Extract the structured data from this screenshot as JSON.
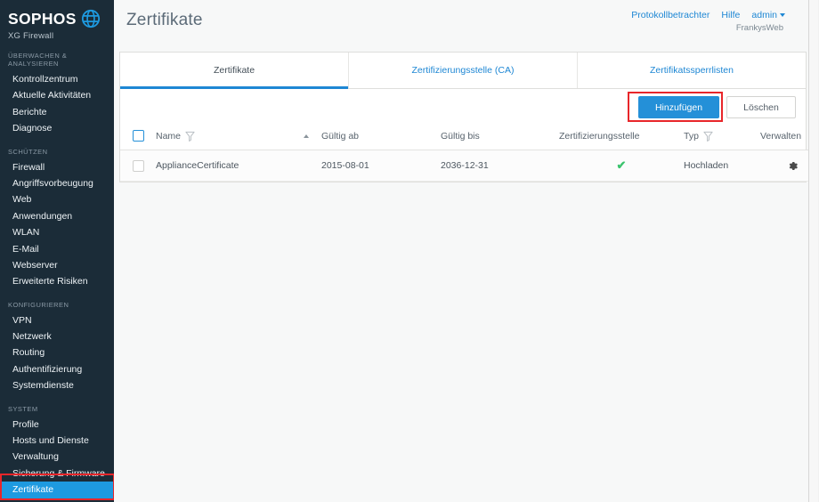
{
  "brand": {
    "name": "SOPHOS",
    "product": "XG Firewall",
    "globe_icon": "globe-icon"
  },
  "sidebar": {
    "sections": [
      {
        "title": "ÜBERWACHEN & ANALYSIEREN",
        "items": [
          {
            "label": "Kontrollzentrum",
            "selected": false
          },
          {
            "label": "Aktuelle Aktivitäten",
            "selected": false
          },
          {
            "label": "Berichte",
            "selected": false
          },
          {
            "label": "Diagnose",
            "selected": false
          }
        ]
      },
      {
        "title": "SCHÜTZEN",
        "items": [
          {
            "label": "Firewall",
            "selected": false
          },
          {
            "label": "Angriffsvorbeugung",
            "selected": false
          },
          {
            "label": "Web",
            "selected": false
          },
          {
            "label": "Anwendungen",
            "selected": false
          },
          {
            "label": "WLAN",
            "selected": false
          },
          {
            "label": "E-Mail",
            "selected": false
          },
          {
            "label": "Webserver",
            "selected": false
          },
          {
            "label": "Erweiterte Risiken",
            "selected": false
          }
        ]
      },
      {
        "title": "KONFIGURIEREN",
        "items": [
          {
            "label": "VPN",
            "selected": false
          },
          {
            "label": "Netzwerk",
            "selected": false
          },
          {
            "label": "Routing",
            "selected": false
          },
          {
            "label": "Authentifizierung",
            "selected": false
          },
          {
            "label": "Systemdienste",
            "selected": false
          }
        ]
      },
      {
        "title": "SYSTEM",
        "items": [
          {
            "label": "Profile",
            "selected": false
          },
          {
            "label": "Hosts und Dienste",
            "selected": false
          },
          {
            "label": "Verwaltung",
            "selected": false
          },
          {
            "label": "Sicherung & Firmware",
            "selected": false
          },
          {
            "label": "Zertifikate",
            "selected": true
          }
        ]
      }
    ]
  },
  "header": {
    "page_title": "Zertifikate",
    "links": [
      {
        "label": "Protokollbetrachter",
        "icon": ""
      },
      {
        "label": "Hilfe",
        "icon": ""
      },
      {
        "label": "admin",
        "icon": "chevron-down-icon"
      }
    ],
    "account": "FrankysWeb"
  },
  "tabs": [
    {
      "label": "Zertifikate",
      "active": true
    },
    {
      "label": "Zertifizierungsstelle (CA)",
      "active": false
    },
    {
      "label": "Zertifikatssperrlisten",
      "active": false
    }
  ],
  "toolbar": {
    "add_label": "Hinzufügen",
    "delete_label": "Löschen"
  },
  "table": {
    "columns": [
      {
        "label": "",
        "icon": "checkbox-icon"
      },
      {
        "label": "Name",
        "icon": "filter-icon"
      },
      {
        "label": "Gültig ab",
        "icon": ""
      },
      {
        "label": "Gültig bis",
        "icon": ""
      },
      {
        "label": "Zertifizierungsstelle",
        "icon": ""
      },
      {
        "label": "Typ",
        "icon": "filter-icon"
      },
      {
        "label": "Verwalten",
        "icon": ""
      }
    ],
    "sort": {
      "column": "Name",
      "direction": "ascending"
    },
    "rows": [
      {
        "name": "ApplianceCertificate",
        "valid_from": "2015-08-01",
        "valid_to": "2036-12-31",
        "ca": "✔",
        "type": "Hochladen",
        "manage_icon": "gear-icon"
      }
    ]
  },
  "annotations": [
    {
      "name": "add-button-highlight",
      "color": "#e8262a"
    },
    {
      "name": "sidebar-zertifikate-highlight",
      "color": "#e8262a"
    }
  ]
}
